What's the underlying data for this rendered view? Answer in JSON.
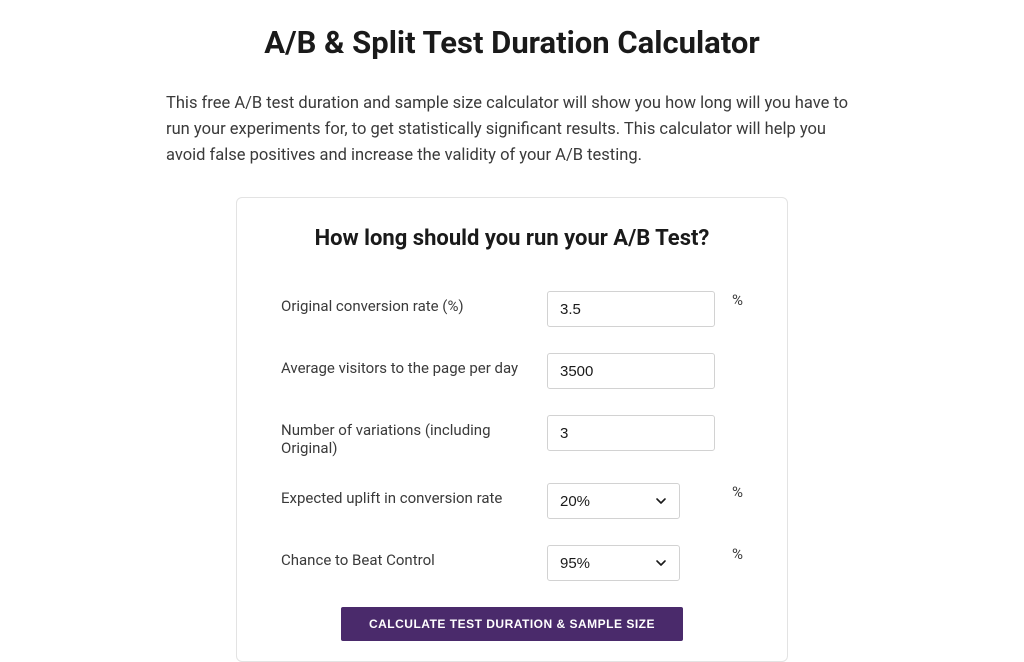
{
  "page": {
    "title": "A/B & Split Test Duration Calculator",
    "description": "This free A/B test duration and sample size calculator will show you how long will you have to run your experiments for, to get statistically significant results. This calculator will help you avoid false positives and increase the validity of your A/B testing."
  },
  "card": {
    "title": "How long should you run your A/B Test?"
  },
  "form": {
    "conversion_rate": {
      "label": "Original conversion rate (%)",
      "value": "3.5",
      "suffix": "%"
    },
    "visitors_per_day": {
      "label": "Average visitors to the page per day",
      "value": "3500"
    },
    "variations": {
      "label": "Number of variations (including Original)",
      "value": "3"
    },
    "uplift": {
      "label": "Expected uplift in conversion rate",
      "value": "20%",
      "suffix": "%"
    },
    "chance_beat": {
      "label": "Chance to Beat Control",
      "value": "95%",
      "suffix": "%"
    },
    "submit_label": "CALCULATE TEST DURATION & SAMPLE SIZE"
  }
}
